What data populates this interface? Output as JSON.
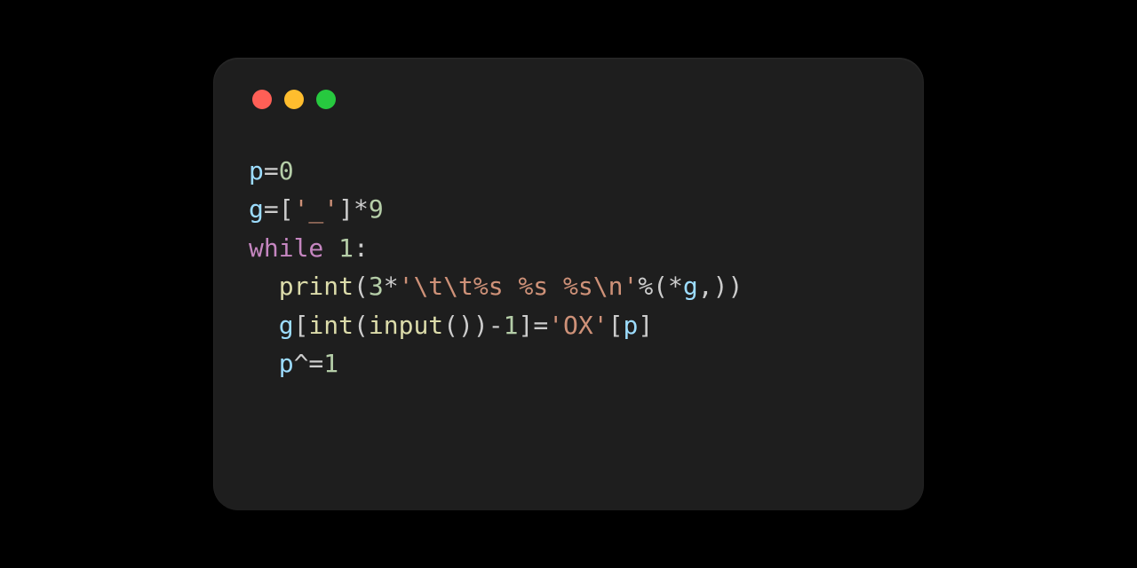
{
  "titlebar": {
    "close": "close",
    "minimize": "minimize",
    "zoom": "zoom"
  },
  "code": {
    "line1": {
      "v": "p",
      "eq": "=",
      "n": "0"
    },
    "line2": {
      "v": "g",
      "eq": "=",
      "lb": "[",
      "s": "'_'",
      "rb": "]",
      "star": "*",
      "n": "9"
    },
    "line3": {
      "kw": "while",
      "sp": " ",
      "n": "1",
      "colon": ":"
    },
    "line4": {
      "indent": "  ",
      "fn": "print",
      "lp": "(",
      "n": "3",
      "star": "*",
      "s": "'\\t\\t%s %s %s\\n'",
      "pct": "%",
      "lp2": "(",
      "starv": "*",
      "v": "g",
      "comma": ",",
      "rp2": ")",
      "rp": ")"
    },
    "line5": {
      "indent": "  ",
      "v": "g",
      "lb": "[",
      "fn1": "int",
      "lp1": "(",
      "fn2": "input",
      "lp2": "(",
      "rp2": ")",
      "rp1": ")",
      "minus": "-",
      "n": "1",
      "rb": "]",
      "eq": "=",
      "s": "'OX'",
      "lb2": "[",
      "v2": "p",
      "rb2": "]"
    },
    "line6": {
      "indent": "  ",
      "v": "p",
      "op": "^=",
      "n": "1"
    }
  }
}
